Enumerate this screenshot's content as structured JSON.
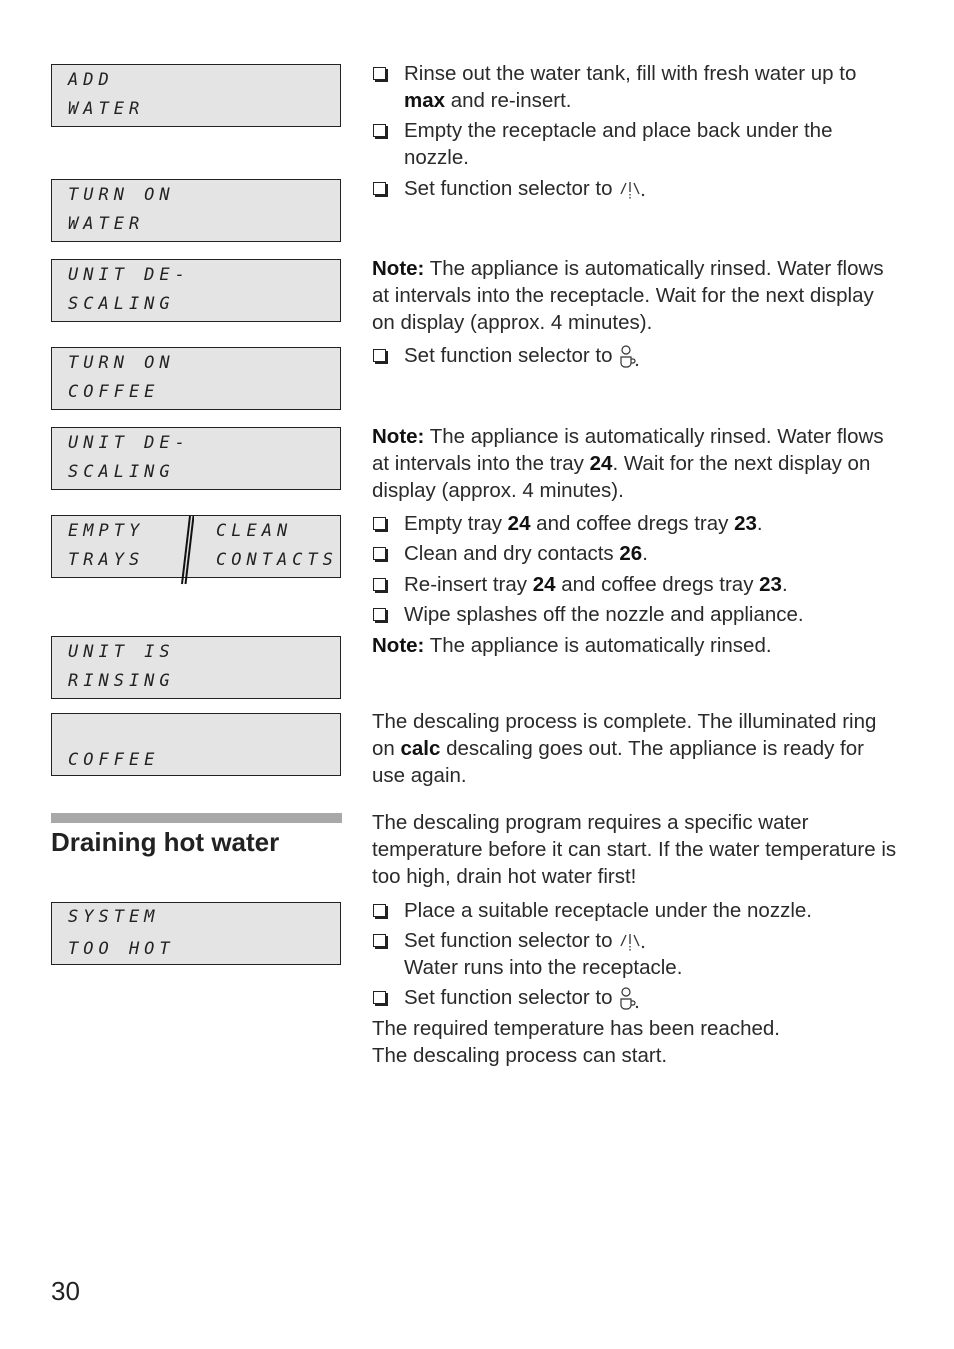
{
  "page_number": "30",
  "lcd_displays": [
    {
      "line1": "ADD",
      "line2": "WATER"
    },
    {
      "line1": "TURN ON",
      "line2": "WATER"
    },
    {
      "line1": "UNIT DE-",
      "line2": "SCALING"
    },
    {
      "line1": "TURN ON",
      "line2": "COFFEE"
    },
    {
      "line1": "UNIT DE-",
      "line2": "SCALING"
    },
    {
      "left_line1": "EMPTY",
      "left_line2": "TRAYS",
      "right_line1": "CLEAN",
      "right_line2": "CONTACTS"
    },
    {
      "line1": "UNIT IS",
      "line2": "RINSING"
    },
    {
      "line1": "",
      "line2": "COFFEE"
    },
    {
      "line1": "SYSTEM",
      "line2": "TOO HOT"
    }
  ],
  "section_heading": "Draining hot water",
  "steps": {
    "s1": {
      "pre": "Rinse out the water tank, fill with fresh water up to ",
      "bold": "max",
      "post": " and re-insert."
    },
    "s2": "Empty the receptacle and place back under the nozzle.",
    "s3": "Set function selector to",
    "note1_label": "Note:",
    "note1": " The appliance is automatically rinsed. Water flows at intervals into the receptacle. Wait for the next display on display (approx. 4 minutes).",
    "s4": "Set function selector to",
    "note2_label": "Note:",
    "note2_pre": " The appliance is automatically rinsed. Water flows at intervals into the tray ",
    "note2_bold": "24",
    "note2_post": ". Wait for the next display on display (approx. 4 minutes).",
    "s5": {
      "a": "Empty tray ",
      "b": "24",
      "c": " and coffee dregs tray ",
      "d": "23",
      "e": "."
    },
    "s6": {
      "a": "Clean and dry contacts ",
      "b": "26",
      "c": "."
    },
    "s7": {
      "a": "Re-insert tray ",
      "b": "24",
      "c": " and coffee dregs tray ",
      "d": "23",
      "e": "."
    },
    "s8": "Wipe splashes off the nozzle and appliance.",
    "note3_label": "Note:",
    "note3": " The appliance is automatically rinsed.",
    "complete_pre": "The descaling process is complete. The illuminated ring on ",
    "complete_bold": "calc",
    "complete_post": " descaling goes out. The appliance is ready for use again.",
    "drain_intro": "The descaling program requires a specific water temperature before it can start. If the water temperature is too high, drain hot water first!",
    "d1": "Place a suitable receptacle under the nozzle.",
    "d2": "Set function selector to",
    "d2_sub": "Water runs into the receptacle.",
    "d3": "Set function selector to",
    "final1": "The required temperature has been reached.",
    "final2": "The descaling process can start."
  },
  "icons": {
    "water": "hot-water-symbol",
    "coffee": "coffee-cup-symbol"
  }
}
